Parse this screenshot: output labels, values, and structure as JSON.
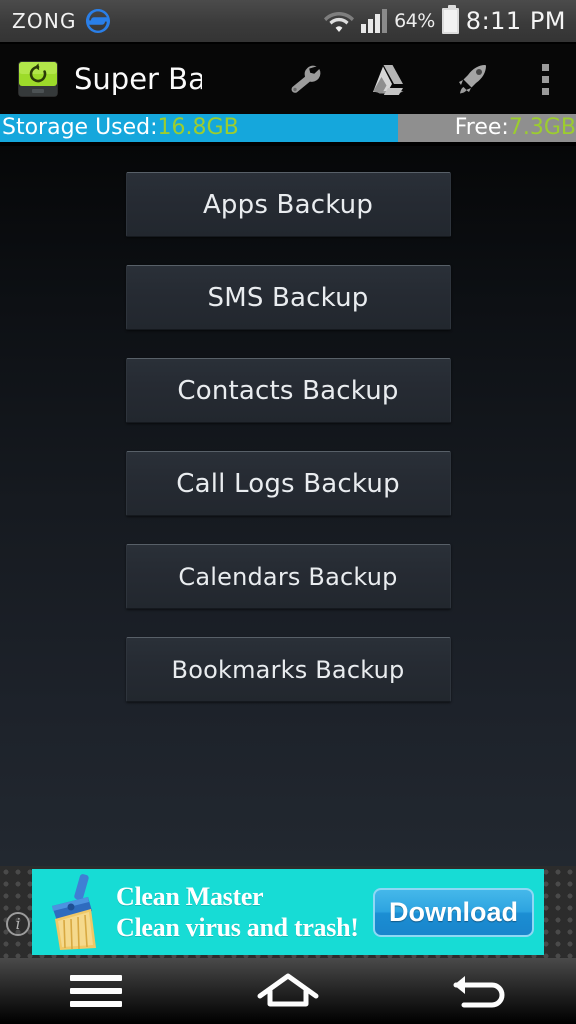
{
  "status_bar": {
    "carrier": "ZONG",
    "carrier_logo_icon": "zong-s-logo-icon",
    "wifi_icon": "wifi-icon",
    "signal_icon": "cellular-signal-icon",
    "battery_percent": "64%",
    "battery_icon": "battery-icon",
    "clock": "8:11 PM"
  },
  "action_bar": {
    "app_icon": "super-backup-app-icon",
    "title": "Super Backup",
    "actions": [
      {
        "name": "wrench-icon",
        "label": "Tools"
      },
      {
        "name": "google-drive-icon",
        "label": "Google Drive"
      },
      {
        "name": "rocket-icon",
        "label": "Boost"
      },
      {
        "name": "overflow-menu-icon",
        "label": "More options"
      }
    ]
  },
  "storage_bar": {
    "used_prefix": "Storage Used:",
    "used_value": "16.8GB",
    "free_prefix": "Free:",
    "free_value": "7.3GB",
    "used_fill_percent": 69,
    "used_color": "#15a7dc",
    "free_color": "#8f8f8f",
    "value_color": "#9ccd2f"
  },
  "main": {
    "buttons": [
      {
        "label": "Apps Backup",
        "size": "large"
      },
      {
        "label": "SMS Backup",
        "size": "large"
      },
      {
        "label": "Contacts Backup",
        "size": "large"
      },
      {
        "label": "Call Logs Backup",
        "size": "large"
      },
      {
        "label": "Calendars Backup",
        "size": "small"
      },
      {
        "label": "Bookmarks Backup",
        "size": "small"
      }
    ]
  },
  "ad": {
    "info_icon": "ad-info-icon",
    "product_icon": "broom-icon",
    "title": "Clean Master",
    "subtitle": "Clean virus and trash!",
    "cta_label": "Download",
    "background_color": "#17dcd5",
    "cta_color": "#2da3e0"
  },
  "nav_bar": {
    "buttons": [
      {
        "name": "menu-icon",
        "label": "Menu"
      },
      {
        "name": "home-icon",
        "label": "Home"
      },
      {
        "name": "back-icon",
        "label": "Back"
      }
    ]
  }
}
